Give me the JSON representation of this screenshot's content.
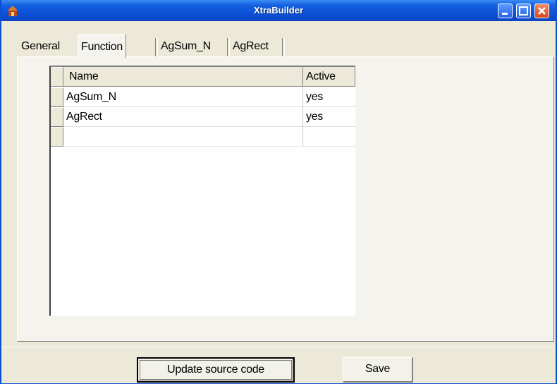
{
  "window": {
    "title": "XtraBuilder"
  },
  "tabs": [
    {
      "label": "General"
    },
    {
      "label": "Function list"
    },
    {
      "label": "AgSum_N"
    },
    {
      "label": "AgRect"
    }
  ],
  "grid": {
    "columns": [
      "Name",
      "Active"
    ],
    "rows": [
      {
        "name": "AgSum_N",
        "active": "yes"
      },
      {
        "name": "AgRect",
        "active": "yes"
      },
      {
        "name": "",
        "active": ""
      }
    ]
  },
  "buttons": {
    "update_label": "Update source code",
    "save_label": "Save"
  }
}
